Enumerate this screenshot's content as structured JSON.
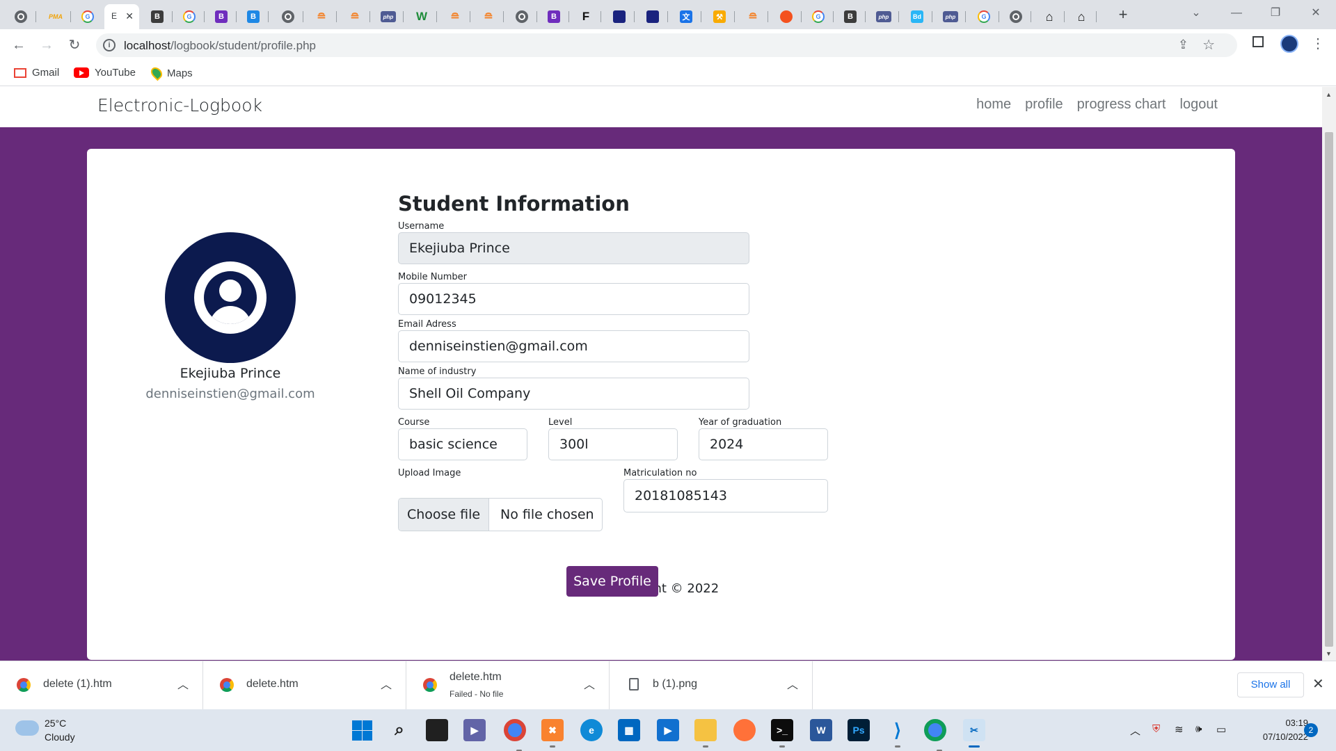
{
  "browser": {
    "active_tab_label": "E",
    "tabs": [
      {
        "icon": "chrome-icon"
      },
      {
        "icon": "phpmyadmin-icon",
        "text": "PMA"
      },
      {
        "icon": "google-icon",
        "text": "G"
      },
      {
        "icon": "active"
      },
      {
        "icon": "bootstrap-icon",
        "text": "B"
      },
      {
        "icon": "google-icon",
        "text": "G"
      },
      {
        "icon": "bootstrap-icon",
        "text": "B"
      },
      {
        "icon": "bootstrap-blue-icon",
        "text": "B"
      },
      {
        "icon": "chrome-icon"
      },
      {
        "icon": "stackoverflow-icon"
      },
      {
        "icon": "stackoverflow-icon"
      },
      {
        "icon": "php-icon",
        "text": "php"
      },
      {
        "icon": "w-icon",
        "text": "W"
      },
      {
        "icon": "stackoverflow-icon"
      },
      {
        "icon": "stackoverflow-icon"
      },
      {
        "icon": "chrome-icon"
      },
      {
        "icon": "bootstrap-icon",
        "text": "B"
      },
      {
        "icon": "f-icon",
        "text": "F"
      },
      {
        "icon": "dark-app-icon"
      },
      {
        "icon": "dark-app-icon"
      },
      {
        "icon": "translate-icon"
      },
      {
        "icon": "tool-icon"
      },
      {
        "icon": "stackoverflow-icon"
      },
      {
        "icon": "orange-circle-icon"
      },
      {
        "icon": "google-icon",
        "text": "G"
      },
      {
        "icon": "bootstrap-dark-icon",
        "text": "B"
      },
      {
        "icon": "php-icon",
        "text": "php"
      },
      {
        "icon": "bd-icon",
        "text": "Bd"
      },
      {
        "icon": "php-icon",
        "text": "php"
      },
      {
        "icon": "google-icon",
        "text": "G"
      },
      {
        "icon": "chrome-icon"
      },
      {
        "icon": "home-icon"
      },
      {
        "icon": "home-icon"
      }
    ],
    "url_host": "localhost",
    "url_path": "/logbook/student/profile.php",
    "bookmarks": [
      {
        "label": "Gmail",
        "icon": "gmail-icon"
      },
      {
        "label": "YouTube",
        "icon": "youtube-icon"
      },
      {
        "label": "Maps",
        "icon": "maps-icon"
      }
    ]
  },
  "site": {
    "brand": "Electronic-Logbook",
    "nav": [
      "home",
      "profile",
      "progress chart",
      "logout"
    ],
    "accent_color": "#672a7a"
  },
  "profile": {
    "name": "Ekejiuba Prince",
    "email": "denniseinstien@gmail.com"
  },
  "form": {
    "title": "Student Information",
    "username_label": "Username",
    "username_value": "Ekejiuba Prince",
    "mobile_label": "Mobile Number",
    "mobile_value": "09012345",
    "email_label": "Email Adress",
    "email_value": "denniseinstien@gmail.com",
    "industry_label": "Name of industry",
    "industry_value": "Shell Oil Company",
    "course_label": "Course",
    "course_value": "basic science",
    "level_label": "Level",
    "level_value": "300l",
    "grad_label": "Year of graduation",
    "grad_value": "2024",
    "upload_label": "Upload Image",
    "upload_button": "Choose file",
    "upload_status": "No file chosen",
    "matric_label": "Matriculation no",
    "matric_value": "20181085143",
    "save_label": "Save Profile"
  },
  "footer": {
    "copyright": "Copyright © 2022"
  },
  "downloads": {
    "items": [
      {
        "name": "delete (1).htm",
        "status": ""
      },
      {
        "name": "delete.htm",
        "status": ""
      },
      {
        "name": "delete.htm",
        "status": "Failed - No file"
      },
      {
        "name": "b (1).png",
        "status": ""
      }
    ],
    "show_all": "Show all"
  },
  "taskbar": {
    "temperature": "25°C",
    "weather": "Cloudy",
    "time": "03:19",
    "date": "07/10/2022",
    "notifications": "2"
  }
}
